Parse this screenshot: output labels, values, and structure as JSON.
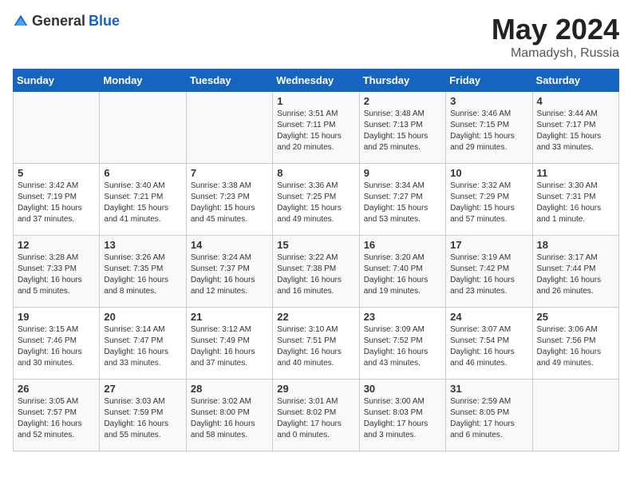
{
  "header": {
    "logo_general": "General",
    "logo_blue": "Blue",
    "title": "May 2024",
    "location": "Mamadysh, Russia"
  },
  "days_of_week": [
    "Sunday",
    "Monday",
    "Tuesday",
    "Wednesday",
    "Thursday",
    "Friday",
    "Saturday"
  ],
  "weeks": [
    [
      {
        "day": "",
        "info": ""
      },
      {
        "day": "",
        "info": ""
      },
      {
        "day": "",
        "info": ""
      },
      {
        "day": "1",
        "info": "Sunrise: 3:51 AM\nSunset: 7:11 PM\nDaylight: 15 hours\nand 20 minutes."
      },
      {
        "day": "2",
        "info": "Sunrise: 3:48 AM\nSunset: 7:13 PM\nDaylight: 15 hours\nand 25 minutes."
      },
      {
        "day": "3",
        "info": "Sunrise: 3:46 AM\nSunset: 7:15 PM\nDaylight: 15 hours\nand 29 minutes."
      },
      {
        "day": "4",
        "info": "Sunrise: 3:44 AM\nSunset: 7:17 PM\nDaylight: 15 hours\nand 33 minutes."
      }
    ],
    [
      {
        "day": "5",
        "info": "Sunrise: 3:42 AM\nSunset: 7:19 PM\nDaylight: 15 hours\nand 37 minutes."
      },
      {
        "day": "6",
        "info": "Sunrise: 3:40 AM\nSunset: 7:21 PM\nDaylight: 15 hours\nand 41 minutes."
      },
      {
        "day": "7",
        "info": "Sunrise: 3:38 AM\nSunset: 7:23 PM\nDaylight: 15 hours\nand 45 minutes."
      },
      {
        "day": "8",
        "info": "Sunrise: 3:36 AM\nSunset: 7:25 PM\nDaylight: 15 hours\nand 49 minutes."
      },
      {
        "day": "9",
        "info": "Sunrise: 3:34 AM\nSunset: 7:27 PM\nDaylight: 15 hours\nand 53 minutes."
      },
      {
        "day": "10",
        "info": "Sunrise: 3:32 AM\nSunset: 7:29 PM\nDaylight: 15 hours\nand 57 minutes."
      },
      {
        "day": "11",
        "info": "Sunrise: 3:30 AM\nSunset: 7:31 PM\nDaylight: 16 hours\nand 1 minute."
      }
    ],
    [
      {
        "day": "12",
        "info": "Sunrise: 3:28 AM\nSunset: 7:33 PM\nDaylight: 16 hours\nand 5 minutes."
      },
      {
        "day": "13",
        "info": "Sunrise: 3:26 AM\nSunset: 7:35 PM\nDaylight: 16 hours\nand 8 minutes."
      },
      {
        "day": "14",
        "info": "Sunrise: 3:24 AM\nSunset: 7:37 PM\nDaylight: 16 hours\nand 12 minutes."
      },
      {
        "day": "15",
        "info": "Sunrise: 3:22 AM\nSunset: 7:38 PM\nDaylight: 16 hours\nand 16 minutes."
      },
      {
        "day": "16",
        "info": "Sunrise: 3:20 AM\nSunset: 7:40 PM\nDaylight: 16 hours\nand 19 minutes."
      },
      {
        "day": "17",
        "info": "Sunrise: 3:19 AM\nSunset: 7:42 PM\nDaylight: 16 hours\nand 23 minutes."
      },
      {
        "day": "18",
        "info": "Sunrise: 3:17 AM\nSunset: 7:44 PM\nDaylight: 16 hours\nand 26 minutes."
      }
    ],
    [
      {
        "day": "19",
        "info": "Sunrise: 3:15 AM\nSunset: 7:46 PM\nDaylight: 16 hours\nand 30 minutes."
      },
      {
        "day": "20",
        "info": "Sunrise: 3:14 AM\nSunset: 7:47 PM\nDaylight: 16 hours\nand 33 minutes."
      },
      {
        "day": "21",
        "info": "Sunrise: 3:12 AM\nSunset: 7:49 PM\nDaylight: 16 hours\nand 37 minutes."
      },
      {
        "day": "22",
        "info": "Sunrise: 3:10 AM\nSunset: 7:51 PM\nDaylight: 16 hours\nand 40 minutes."
      },
      {
        "day": "23",
        "info": "Sunrise: 3:09 AM\nSunset: 7:52 PM\nDaylight: 16 hours\nand 43 minutes."
      },
      {
        "day": "24",
        "info": "Sunrise: 3:07 AM\nSunset: 7:54 PM\nDaylight: 16 hours\nand 46 minutes."
      },
      {
        "day": "25",
        "info": "Sunrise: 3:06 AM\nSunset: 7:56 PM\nDaylight: 16 hours\nand 49 minutes."
      }
    ],
    [
      {
        "day": "26",
        "info": "Sunrise: 3:05 AM\nSunset: 7:57 PM\nDaylight: 16 hours\nand 52 minutes."
      },
      {
        "day": "27",
        "info": "Sunrise: 3:03 AM\nSunset: 7:59 PM\nDaylight: 16 hours\nand 55 minutes."
      },
      {
        "day": "28",
        "info": "Sunrise: 3:02 AM\nSunset: 8:00 PM\nDaylight: 16 hours\nand 58 minutes."
      },
      {
        "day": "29",
        "info": "Sunrise: 3:01 AM\nSunset: 8:02 PM\nDaylight: 17 hours\nand 0 minutes."
      },
      {
        "day": "30",
        "info": "Sunrise: 3:00 AM\nSunset: 8:03 PM\nDaylight: 17 hours\nand 3 minutes."
      },
      {
        "day": "31",
        "info": "Sunrise: 2:59 AM\nSunset: 8:05 PM\nDaylight: 17 hours\nand 6 minutes."
      },
      {
        "day": "",
        "info": ""
      }
    ]
  ]
}
